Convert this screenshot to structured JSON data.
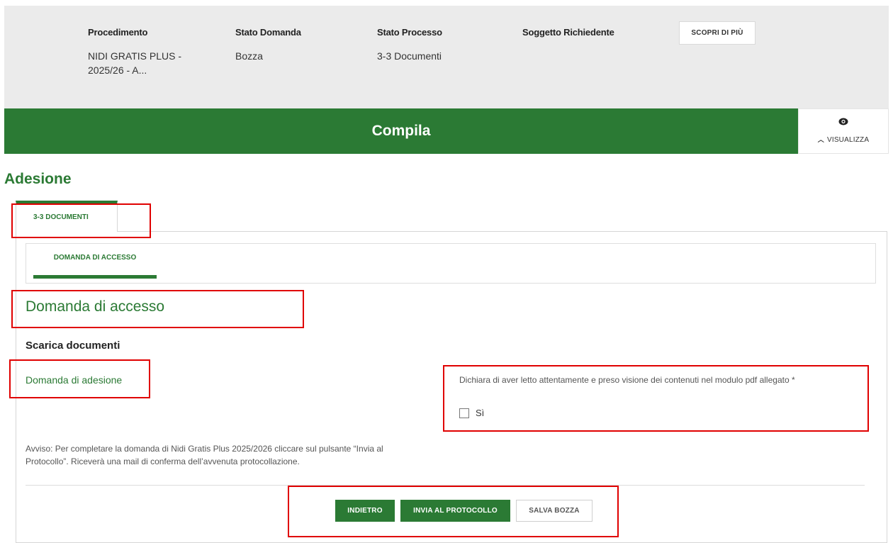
{
  "info": {
    "procedimento_label": "Procedimento",
    "procedimento_value": "NIDI GRATIS PLUS - 2025/26 - A...",
    "stato_domanda_label": "Stato Domanda",
    "stato_domanda_value": "Bozza",
    "stato_processo_label": "Stato Processo",
    "stato_processo_value": "3-3 Documenti",
    "soggetto_label": "Soggetto Richiedente",
    "soggetto_value": "",
    "scopri_button": "SCOPRI DI PIÙ"
  },
  "green_bar": {
    "title": "Compila"
  },
  "visualizza": {
    "label": "VISUALIZZA",
    "icon": "eye-icon"
  },
  "section_title": "Adesione",
  "tabs": [
    {
      "label": "3-3 DOCUMENTI",
      "active": true
    }
  ],
  "subtabs": [
    {
      "label": "DOMANDA DI ACCESSO",
      "active": true
    }
  ],
  "form": {
    "title": "Domanda di accesso",
    "scarica_heading": "Scarica documenti",
    "document_link": "Domanda di adesione",
    "dichiara_text": "Dichiara di aver letto attentamente e preso visione dei contenuti nel modulo pdf allegato *",
    "checkbox_label": "Sì",
    "checkbox_checked": false,
    "avviso_text": "Avviso: Per completare la domanda di Nidi Gratis Plus 2025/2026 cliccare sul pulsante “Invia al Protocollo”. Riceverà una mail di conferma dell’avvenuta protocollazione."
  },
  "buttons": {
    "indietro": "INDIETRO",
    "invia": "INVIA AL PROTOCOLLO",
    "salva": "SALVA BOZZA"
  },
  "colors": {
    "primary_green": "#2b7a34",
    "header_gray": "#ebebeb",
    "highlight_red": "#e00000"
  }
}
